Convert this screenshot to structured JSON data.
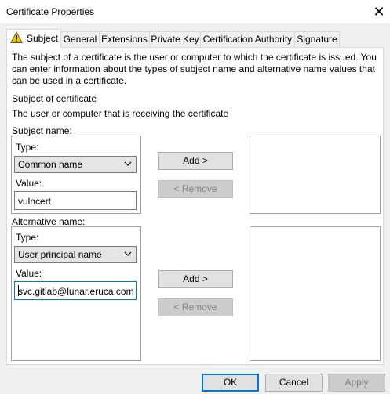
{
  "window": {
    "title": "Certificate Properties",
    "close_glyph": "✕"
  },
  "tabs": [
    {
      "label": "Subject",
      "active": true,
      "icon": "warning-icon"
    },
    {
      "label": "General"
    },
    {
      "label": "Extensions"
    },
    {
      "label": "Private Key"
    },
    {
      "label": "Certification Authority"
    },
    {
      "label": "Signature"
    }
  ],
  "subject_tab": {
    "intro": "The subject of a certificate is the user or computer to which the certificate is issued. You can enter information about the types of subject name and alternative name values that can be used in a certificate.",
    "subject_of_certificate_heading": "Subject of certificate",
    "subject_of_certificate_desc": "The user or computer that is receiving the certificate",
    "subject_name": {
      "label": "Subject name:",
      "type_label": "Type:",
      "type_value": "Common name",
      "value_label": "Value:",
      "value": "vulncert",
      "add_button": "Add >",
      "remove_button": "< Remove"
    },
    "alternative_name": {
      "label": "Alternative name:",
      "type_label": "Type:",
      "type_value": "User principal name",
      "value_label": "Value:",
      "value": "svc.gitlab@lunar.eruca.com",
      "add_button": "Add >",
      "remove_button": "< Remove"
    }
  },
  "footer": {
    "ok": "OK",
    "cancel": "Cancel",
    "apply": "Apply"
  },
  "colors": {
    "accent": "#0078d7",
    "warning": "#f5c400"
  }
}
